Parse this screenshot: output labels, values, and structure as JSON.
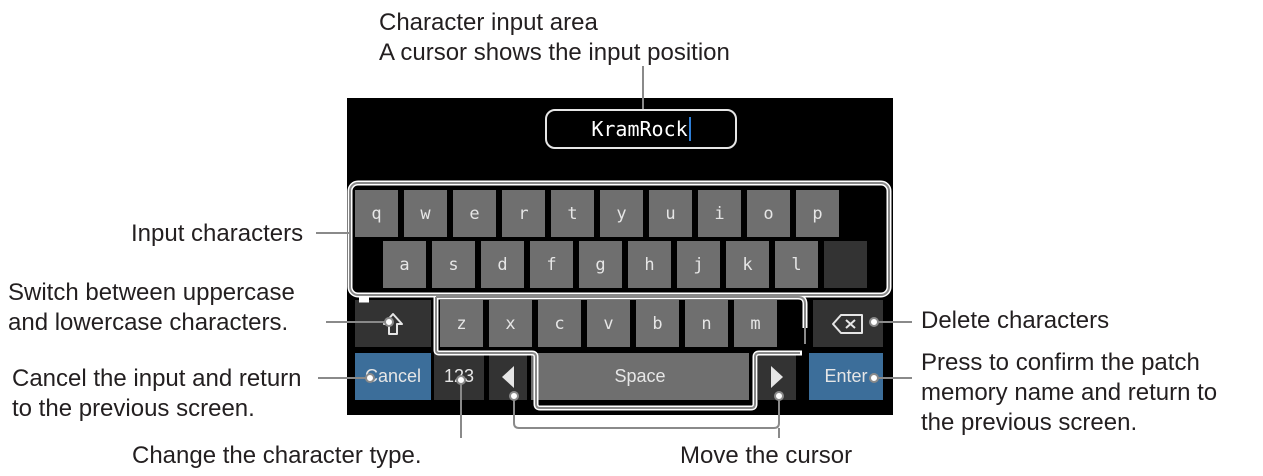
{
  "callouts": {
    "input_area_line1": "Character input area",
    "input_area_line2": "A cursor shows the input position",
    "input_chars": "Input characters",
    "shift_line1": "Switch between uppercase",
    "shift_line2": "and lowercase characters.",
    "cancel_line1": "Cancel the input and return",
    "cancel_line2": "to the previous screen.",
    "delete": "Delete characters",
    "enter_line1": "Press to confirm the patch",
    "enter_line2": "memory name and return to",
    "enter_line3": "the previous screen.",
    "char_type": "Change the character type.",
    "move_cursor": "Move the cursor"
  },
  "screen": {
    "name_value": "KramRock",
    "row1": [
      "q",
      "w",
      "e",
      "r",
      "t",
      "y",
      "u",
      "i",
      "o",
      "p"
    ],
    "row2": [
      "a",
      "s",
      "d",
      "f",
      "g",
      "h",
      "j",
      "k",
      "l"
    ],
    "row3": [
      "z",
      "x",
      "c",
      "v",
      "b",
      "n",
      "m"
    ],
    "cancel": "Cancel",
    "num": "123",
    "space": "Space",
    "enter": "Enter"
  },
  "colors": {
    "key": "#6f6f6f",
    "key_dark": "#333333",
    "accent_blue": "#3c6e9a",
    "screen_bg": "#000000",
    "text": "#231f20"
  }
}
